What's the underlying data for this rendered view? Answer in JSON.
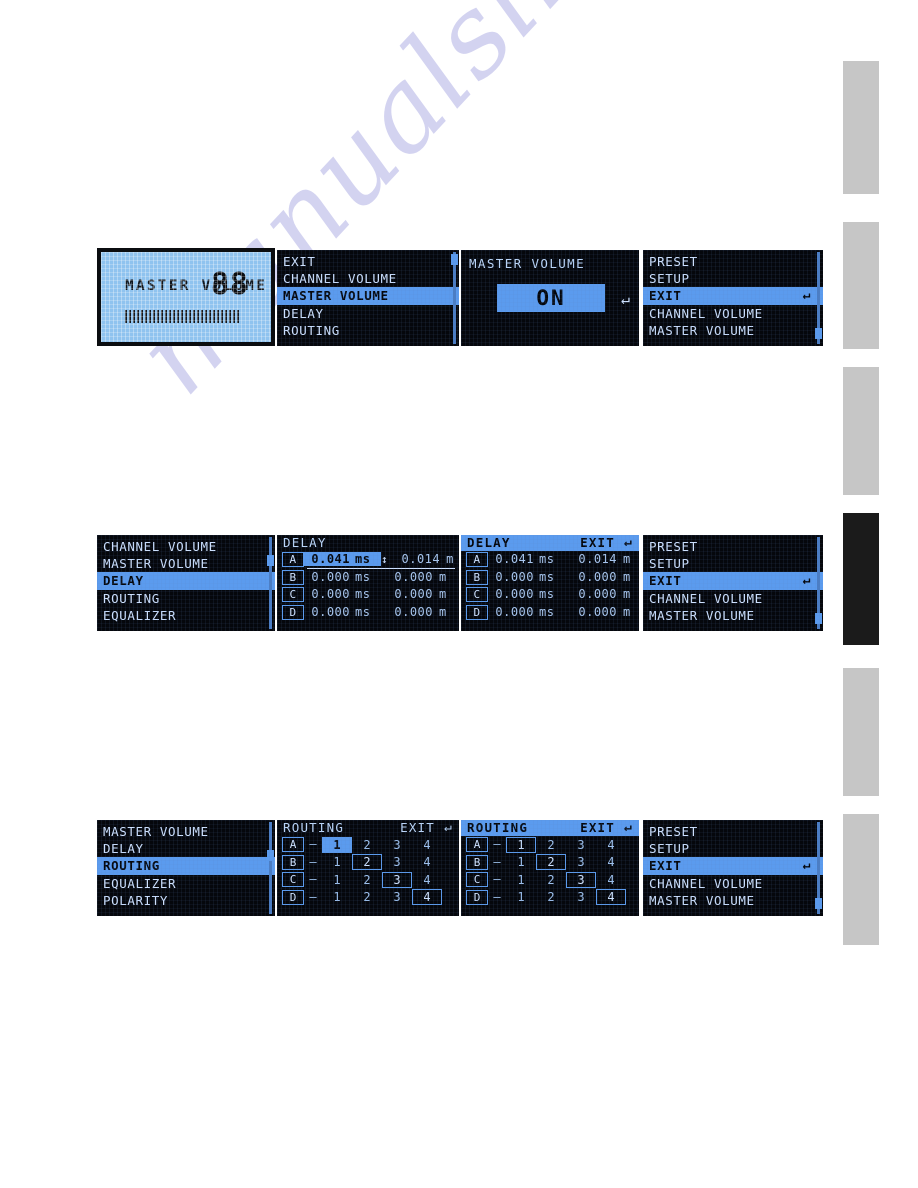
{
  "watermark": {
    "text": "manualslive.com"
  },
  "tab_strip": {
    "tabs": [
      {
        "name": "tab-1",
        "active": false
      },
      {
        "name": "tab-2",
        "active": false
      },
      {
        "name": "tab-3",
        "active": false
      },
      {
        "name": "tab-4",
        "active": true
      },
      {
        "name": "tab-5",
        "active": false
      },
      {
        "name": "tab-6",
        "active": false
      }
    ],
    "active_color": "#1b1b1b",
    "inactive_color": "#c6c6c6"
  },
  "colors": {
    "lcd_dark_bg": "#05070c",
    "lcd_light_bg": "#8fc3ef",
    "highlight": "#5b9bee",
    "text": "#cfe2ff"
  },
  "row1": {
    "master_volume_lcd": {
      "label": "MASTER VOLUME",
      "value": "88",
      "bar_percent": 88
    },
    "menu_master": {
      "items": [
        {
          "label": "EXIT",
          "selected": false,
          "return_icon": false
        },
        {
          "label": "CHANNEL  VOLUME",
          "selected": false,
          "return_icon": false
        },
        {
          "label": "MASTER  VOLUME",
          "selected": true,
          "return_icon": false
        },
        {
          "label": "DELAY",
          "selected": false,
          "return_icon": false
        },
        {
          "label": "ROUTING",
          "selected": false,
          "return_icon": false
        }
      ]
    },
    "master_on": {
      "title": "MASTER VOLUME",
      "value": "ON",
      "return_icon": "return-arrow"
    },
    "menu_exit": {
      "items": [
        {
          "label": "PRESET",
          "selected": false,
          "return_icon": false
        },
        {
          "label": "SETUP",
          "selected": false,
          "return_icon": false
        },
        {
          "label": "EXIT",
          "selected": true,
          "return_icon": true
        },
        {
          "label": "CHANNEL  VOLUME",
          "selected": false,
          "return_icon": false
        },
        {
          "label": "MASTER  VOLUME",
          "selected": false,
          "return_icon": false
        }
      ]
    }
  },
  "row2": {
    "menu_delay": {
      "items": [
        {
          "label": "CHANNEL  VOLUME",
          "selected": false,
          "return_icon": false
        },
        {
          "label": "MASTER  VOLUME",
          "selected": false,
          "return_icon": false
        },
        {
          "label": "DELAY",
          "selected": true,
          "return_icon": false
        },
        {
          "label": "ROUTING",
          "selected": false,
          "return_icon": false
        },
        {
          "label": "EQUALIZER",
          "selected": false,
          "return_icon": false
        }
      ]
    },
    "delay_edit": {
      "title": "DELAY",
      "title_highlighted": false,
      "exit_label": "",
      "rows": [
        {
          "channel": "A",
          "ms": "0.041",
          "ms_unit": "ms",
          "m": "0.014",
          "m_unit": "m",
          "editing": true
        },
        {
          "channel": "B",
          "ms": "0.000",
          "ms_unit": "ms",
          "m": "0.000",
          "m_unit": "m",
          "editing": false
        },
        {
          "channel": "C",
          "ms": "0.000",
          "ms_unit": "ms",
          "m": "0.000",
          "m_unit": "m",
          "editing": false
        },
        {
          "channel": "D",
          "ms": "0.000",
          "ms_unit": "ms",
          "m": "0.000",
          "m_unit": "m",
          "editing": false
        }
      ]
    },
    "delay_view": {
      "title": "DELAY",
      "title_highlighted": true,
      "exit_label": "EXIT",
      "return_icon": "return-arrow",
      "rows": [
        {
          "channel": "A",
          "ms": "0.041",
          "ms_unit": "ms",
          "m": "0.014",
          "m_unit": "m",
          "editing": false
        },
        {
          "channel": "B",
          "ms": "0.000",
          "ms_unit": "ms",
          "m": "0.000",
          "m_unit": "m",
          "editing": false
        },
        {
          "channel": "C",
          "ms": "0.000",
          "ms_unit": "ms",
          "m": "0.000",
          "m_unit": "m",
          "editing": false
        },
        {
          "channel": "D",
          "ms": "0.000",
          "ms_unit": "ms",
          "m": "0.000",
          "m_unit": "m",
          "editing": false
        }
      ]
    },
    "menu_exit": {
      "items": [
        {
          "label": "PRESET",
          "selected": false,
          "return_icon": false
        },
        {
          "label": "SETUP",
          "selected": false,
          "return_icon": false
        },
        {
          "label": "EXIT",
          "selected": true,
          "return_icon": true
        },
        {
          "label": "CHANNEL  VOLUME",
          "selected": false,
          "return_icon": false
        },
        {
          "label": "MASTER  VOLUME",
          "selected": false,
          "return_icon": false
        }
      ]
    }
  },
  "row3": {
    "menu_routing": {
      "items": [
        {
          "label": "MASTER  VOLUME",
          "selected": false,
          "return_icon": false
        },
        {
          "label": "DELAY",
          "selected": false,
          "return_icon": false
        },
        {
          "label": "ROUTING",
          "selected": true,
          "return_icon": false
        },
        {
          "label": "EQUALIZER",
          "selected": false,
          "return_icon": false
        },
        {
          "label": "POLARITY",
          "selected": false,
          "return_icon": false
        }
      ]
    },
    "routing_edit": {
      "title": "ROUTING",
      "title_highlighted": false,
      "exit_label": "EXIT",
      "return_icon": "return-arrow",
      "columns": [
        "1",
        "2",
        "3",
        "4"
      ],
      "rows": [
        {
          "channel": "A",
          "selected": "1",
          "filled": true
        },
        {
          "channel": "B",
          "selected": "2",
          "filled": false
        },
        {
          "channel": "C",
          "selected": "3",
          "filled": false
        },
        {
          "channel": "D",
          "selected": "4",
          "filled": false
        }
      ]
    },
    "routing_view": {
      "title": "ROUTING",
      "title_highlighted": true,
      "exit_label": "EXIT",
      "return_icon": "return-arrow",
      "columns": [
        "1",
        "2",
        "3",
        "4"
      ],
      "rows": [
        {
          "channel": "A",
          "selected": "1",
          "filled": false
        },
        {
          "channel": "B",
          "selected": "2",
          "filled": false
        },
        {
          "channel": "C",
          "selected": "3",
          "filled": false
        },
        {
          "channel": "D",
          "selected": "4",
          "filled": false
        }
      ]
    },
    "menu_exit": {
      "items": [
        {
          "label": "PRESET",
          "selected": false,
          "return_icon": false
        },
        {
          "label": "SETUP",
          "selected": false,
          "return_icon": false
        },
        {
          "label": "EXIT",
          "selected": true,
          "return_icon": true
        },
        {
          "label": "CHANNEL  VOLUME",
          "selected": false,
          "return_icon": false
        },
        {
          "label": "MASTER  VOLUME",
          "selected": false,
          "return_icon": false
        }
      ]
    }
  }
}
